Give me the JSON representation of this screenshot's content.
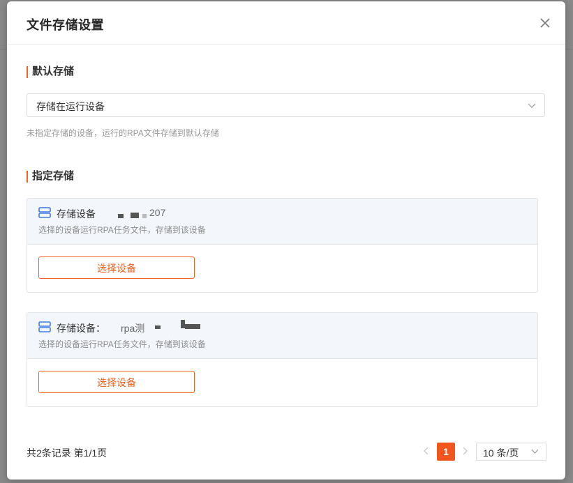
{
  "modal": {
    "title": "文件存储设置"
  },
  "default_storage": {
    "section_title": "默认存储",
    "selected": "存储在运行设备",
    "hint": "未指定存储的设备，运行的RPA文件存储到默认存储"
  },
  "specified_storage": {
    "section_title": "指定存储",
    "cards": [
      {
        "label": "存储设备",
        "device_visible_suffix": "207",
        "desc": "选择的设备运行RPA任务文件，存储到该设备",
        "button_label": "选择设备"
      },
      {
        "label": "存储设备：",
        "device_visible_suffix": "rpa测",
        "desc": "选择的设备运行RPA任务文件，存储到该设备",
        "button_label": "选择设备"
      }
    ]
  },
  "pagination": {
    "total_text": "共2条记录 第1/1页",
    "current_page": "1",
    "page_size": "10 条/页"
  },
  "colors": {
    "accent": "#f0611e",
    "storage_icon": "#3f7ae6"
  }
}
